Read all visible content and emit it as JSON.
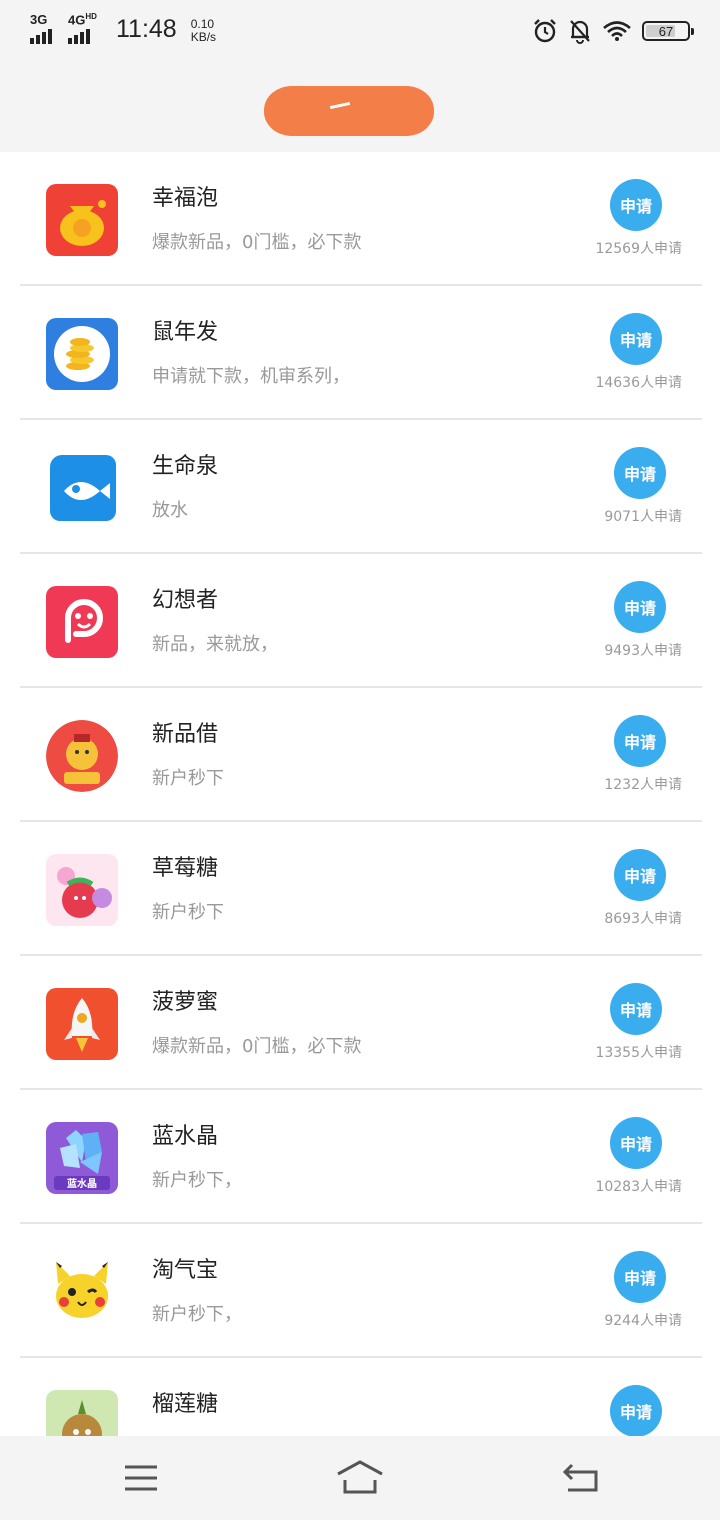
{
  "status_bar": {
    "network_1": "3G",
    "network_2": "4G",
    "network_2_sup": "HD",
    "time": "11:48",
    "speed_value": "0.10",
    "speed_unit": "KB/s",
    "battery": "67",
    "battery_level_percent": 67,
    "icons": [
      "alarm-icon",
      "bell-off-icon",
      "wifi-icon",
      "battery-icon"
    ]
  },
  "header": {
    "title_redacted": true,
    "redaction_color": "#f47e48"
  },
  "accent_color": "#3aadef",
  "items": [
    {
      "name": "幸福泡",
      "desc": "爆款新品，0门槛，必下款",
      "button": "申请",
      "count": "12569人申请",
      "icon": "money-bag-icon"
    },
    {
      "name": "鼠年发",
      "desc": "申请就下款，机审系列，",
      "button": "申请",
      "count": "14636人申请",
      "icon": "gold-coins-icon"
    },
    {
      "name": "生命泉",
      "desc": "放水",
      "button": "申请",
      "count": "9071人申请",
      "icon": "fish-icon"
    },
    {
      "name": "幻想者",
      "desc": "新品，来就放，",
      "button": "申请",
      "count": "9493人申请",
      "icon": "smile-face-icon"
    },
    {
      "name": "新品借",
      "desc": "新户秒下",
      "button": "申请",
      "count": "1232人申请",
      "icon": "lucky-cat-icon"
    },
    {
      "name": "草莓糖",
      "desc": "新户秒下",
      "button": "申请",
      "count": "8693人申请",
      "icon": "strawberry-candy-icon"
    },
    {
      "name": "菠萝蜜",
      "desc": "爆款新品，0门槛，必下款",
      "button": "申请",
      "count": "13355人申请",
      "icon": "rocket-icon"
    },
    {
      "name": "蓝水晶",
      "desc": "新户秒下，",
      "button": "申请",
      "count": "10283人申请",
      "icon": "crystal-icon",
      "icon_text": "蓝水晶"
    },
    {
      "name": "淘气宝",
      "desc": "新户秒下，",
      "button": "申请",
      "count": "9244人申请",
      "icon": "pikachu-icon"
    },
    {
      "name": "榴莲糖",
      "desc": "",
      "button": "申请",
      "count": "",
      "icon": "durian-icon"
    }
  ],
  "nav": {
    "icons": [
      "menu-icon",
      "home-icon",
      "back-icon"
    ]
  }
}
